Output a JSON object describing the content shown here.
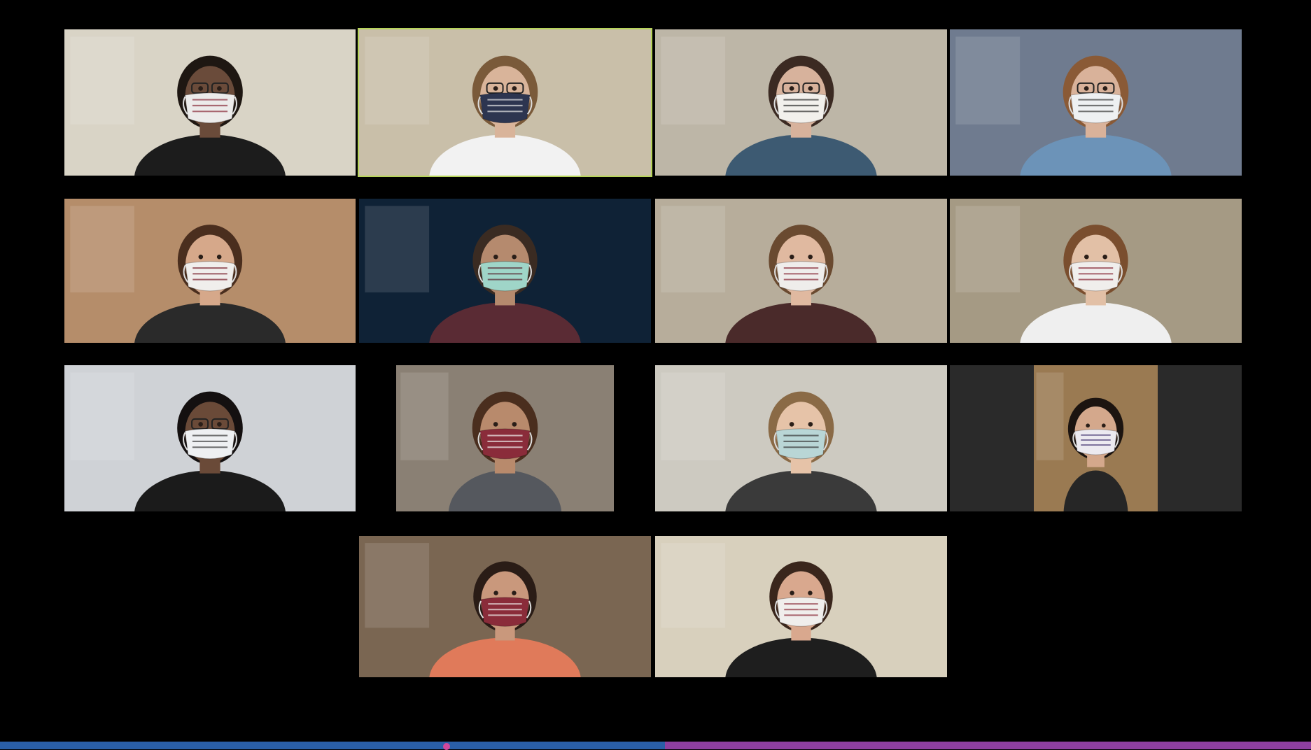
{
  "meeting": {
    "view": "gallery",
    "participant_count": 14,
    "active_speaker_index": 1
  },
  "participants": [
    {
      "bg": "#d9d4c6",
      "skin": "#6a4b3a",
      "hair": "#1e1712",
      "shirt": "#1c1c1c",
      "mask": "#ecebea",
      "mask_accent": "#8a2c3a",
      "glasses": true
    },
    {
      "bg": "#c9bfa9",
      "skin": "#d9b49a",
      "hair": "#7a5a3a",
      "shirt": "#f2f2f2",
      "mask": "#2d3550",
      "mask_accent": "#e6e6e6",
      "glasses": true
    },
    {
      "bg": "#bdb6a7",
      "skin": "#d7b29c",
      "hair": "#3b2a22",
      "shirt": "#3d5a72",
      "mask": "#f2f0ec",
      "mask_accent": "#2c2c2c",
      "glasses": true
    },
    {
      "bg": "#6f7b8f",
      "skin": "#d9b29a",
      "hair": "#8a5a36",
      "shirt": "#6c93b8",
      "mask": "#eef0f2",
      "mask_accent": "#3a3a3a",
      "glasses": true
    },
    {
      "bg": "#b58d6a",
      "skin": "#d6a88a",
      "hair": "#4a2e1e",
      "shirt": "#2a2a2a",
      "mask": "#f0eeec",
      "mask_accent": "#7a2430",
      "glasses": false
    },
    {
      "bg": "#0f2236",
      "skin": "#b58a6e",
      "hair": "#3a2b22",
      "shirt": "#5a2b34",
      "mask": "#9fd5c8",
      "mask_accent": "#5a2b34",
      "glasses": false
    },
    {
      "bg": "#b7ad9b",
      "skin": "#e0b9a0",
      "hair": "#6a4a30",
      "shirt": "#4a2a2a",
      "mask": "#efedeb",
      "mask_accent": "#8a2c3a",
      "glasses": false
    },
    {
      "bg": "#a59a84",
      "skin": "#e2c0a6",
      "hair": "#7a4e2e",
      "shirt": "#efefef",
      "mask": "#f0eeec",
      "mask_accent": "#8a2c3a",
      "glasses": false
    },
    {
      "bg": "#cfd2d6",
      "skin": "#6a4a38",
      "hair": "#141010",
      "shirt": "#1b1b1b",
      "mask": "#eef0f2",
      "mask_accent": "#3a3a3a",
      "glasses": true
    },
    {
      "bg": "#8a8074",
      "skin": "#b88a6c",
      "hair": "#4a2e1e",
      "shirt": "#55585e",
      "mask": "#8a2c3a",
      "mask_accent": "#f0eeec",
      "glasses": false
    },
    {
      "bg": "#cdcac1",
      "skin": "#e6c3a8",
      "hair": "#8a6a46",
      "shirt": "#3a3a3a",
      "mask": "#b9d6d6",
      "mask_accent": "#3a3a3a",
      "glasses": false
    },
    {
      "bg": "#9a7a52",
      "skin": "#d4a88c",
      "hair": "#1c1410",
      "shirt": "#262626",
      "mask": "#eceaf0",
      "mask_accent": "#3a2a6a",
      "glasses": false
    },
    {
      "bg": "#7a6652",
      "skin": "#c9987c",
      "hair": "#2a1c16",
      "shirt": "#e07a5a",
      "mask": "#8a2c3a",
      "mask_accent": "#f0eeec",
      "glasses": false
    },
    {
      "bg": "#d8d0bd",
      "skin": "#d9a88e",
      "hair": "#3a261c",
      "shirt": "#1e1e1e",
      "mask": "#f0eeec",
      "mask_accent": "#8a2c3a",
      "glasses": false
    }
  ],
  "bottom_bar": {
    "left_color": "#2a5fa8",
    "right_color": "#8e3fa0",
    "marker_color": "#d1479b"
  }
}
